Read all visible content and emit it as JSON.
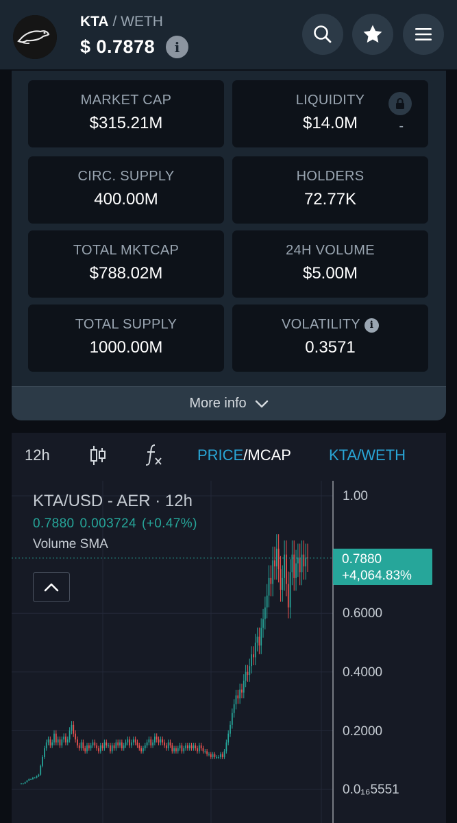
{
  "header": {
    "base": "KTA",
    "separator": " / ",
    "quote": "WETH",
    "price": "$  0.7878",
    "info_glyph": "i"
  },
  "stats": [
    {
      "label": "MARKET CAP",
      "value": "$315.21M"
    },
    {
      "label": "LIQUIDITY",
      "value": "$14.0M",
      "extra": "-"
    },
    {
      "label": "CIRC. SUPPLY",
      "value": "400.00M"
    },
    {
      "label": "HOLDERS",
      "value": "72.77K"
    },
    {
      "label": "TOTAL MKTCAP",
      "value": "$788.02M"
    },
    {
      "label": "24H VOLUME",
      "value": "$5.00M"
    },
    {
      "label": "TOTAL SUPPLY",
      "value": "1000.00M"
    },
    {
      "label": "VOLATILITY",
      "value": "0.3571"
    }
  ],
  "more_info_label": "More info",
  "chart_toolbar": {
    "interval": "12h",
    "price_label": "PRICE",
    "slash": "/",
    "mcap_label": "MCAP",
    "pair_label": "KTA/WETH"
  },
  "legend": {
    "title": "KTA/USD - AER · 12h",
    "last": "0.7880",
    "change": "0.003724",
    "change_pct": "(+0.47%)",
    "sma": "Volume SMA"
  },
  "price_tag": {
    "price": "0.7880",
    "change": "+4,064.83%"
  },
  "colors": {
    "up": "#26a69a",
    "down": "#ef5350",
    "accent": "#29a6d6",
    "panel": "#1b2631",
    "card": "#0d1219",
    "chart_bg": "#161a25"
  },
  "chart_data": {
    "type": "candlestick",
    "title": "KTA/USD - AER · 12h",
    "y_axis_labels": [
      "1.00",
      "0.6000",
      "0.4000",
      "0.2000",
      "0.0₁₆5551"
    ],
    "ylim": [
      0,
      1.0
    ],
    "last_price": 0.788,
    "approx_close_series": [
      0.02,
      0.02,
      0.025,
      0.03,
      0.035,
      0.035,
      0.04,
      0.04,
      0.045,
      0.05,
      0.08,
      0.11,
      0.14,
      0.16,
      0.17,
      0.15,
      0.16,
      0.19,
      0.16,
      0.17,
      0.15,
      0.17,
      0.18,
      0.16,
      0.17,
      0.2,
      0.22,
      0.19,
      0.17,
      0.15,
      0.14,
      0.16,
      0.14,
      0.13,
      0.15,
      0.14,
      0.15,
      0.16,
      0.15,
      0.14,
      0.13,
      0.15,
      0.14,
      0.16,
      0.15,
      0.15,
      0.13,
      0.15,
      0.14,
      0.16,
      0.15,
      0.16,
      0.14,
      0.15,
      0.16,
      0.17,
      0.15,
      0.16,
      0.17,
      0.16,
      0.15,
      0.14,
      0.13,
      0.14,
      0.15,
      0.16,
      0.17,
      0.15,
      0.16,
      0.18,
      0.17,
      0.16,
      0.17,
      0.16,
      0.15,
      0.14,
      0.16,
      0.15,
      0.13,
      0.14,
      0.13,
      0.14,
      0.15,
      0.13,
      0.14,
      0.15,
      0.14,
      0.15,
      0.14,
      0.15,
      0.14,
      0.13,
      0.15,
      0.14,
      0.13,
      0.13,
      0.12,
      0.12,
      0.11,
      0.12,
      0.11,
      0.11,
      0.11,
      0.12,
      0.11,
      0.13,
      0.16,
      0.19,
      0.22,
      0.26,
      0.29,
      0.32,
      0.31,
      0.34,
      0.33,
      0.37,
      0.4,
      0.39,
      0.42,
      0.46,
      0.45,
      0.5,
      0.52,
      0.49,
      0.55,
      0.58,
      0.62,
      0.66,
      0.72,
      0.7,
      0.78,
      0.76,
      0.82,
      0.75,
      0.68,
      0.72,
      0.8,
      0.7,
      0.62,
      0.74,
      0.8,
      0.72,
      0.77,
      0.79,
      0.74,
      0.8,
      0.76,
      0.79,
      0.788
    ]
  }
}
